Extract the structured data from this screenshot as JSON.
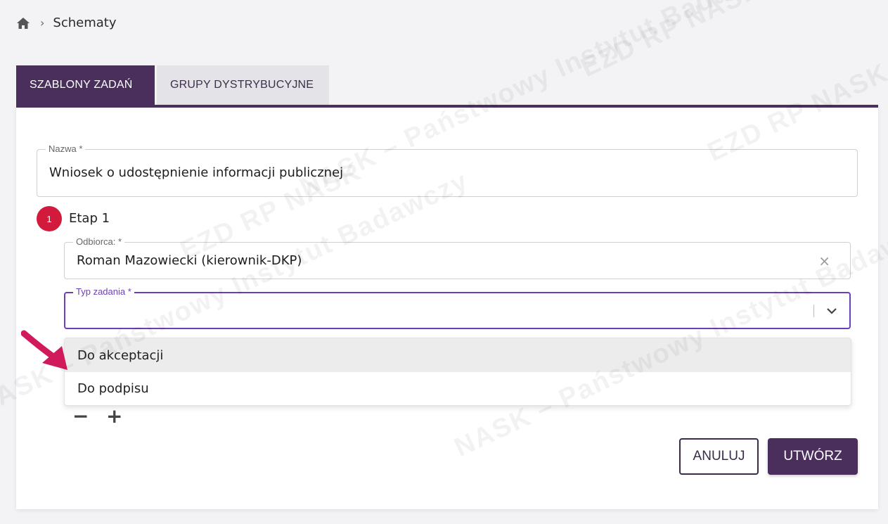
{
  "breadcrumb": {
    "home_icon": "home-icon",
    "separator": "›",
    "current": "Schematy"
  },
  "tabs": [
    {
      "label": "SZABLONY ZADAŃ",
      "active": true
    },
    {
      "label": "GRUPY DYSTRYBUCYJNE",
      "active": false
    }
  ],
  "form": {
    "name_field": {
      "label": "Nazwa *",
      "value": "Wniosek o udostępnienie informacji publicznej"
    },
    "step": {
      "number": "1",
      "label": "Etap 1"
    },
    "recipient_field": {
      "label": "Odbiorca: *",
      "value": "Roman Mazowiecki (kierownik-DKP)",
      "clear_icon": "×"
    },
    "task_type_field": {
      "label": "Typ zadania *",
      "value": ""
    },
    "task_type_options": [
      "Do akceptacji",
      "Do podpisu"
    ],
    "remove_step": "−",
    "add_step": "+"
  },
  "buttons": {
    "cancel": "ANULUJ",
    "create": "UTWÓRZ"
  },
  "colors": {
    "primary": "#4a2f5c",
    "focus": "#6c3fb8",
    "step_badge": "#d11a3c",
    "arrow": "#d11a5c"
  },
  "watermark": {
    "lines": [
      "NASK – Państwowy Instytut Badawczy",
      "EZD RP NASK"
    ]
  }
}
